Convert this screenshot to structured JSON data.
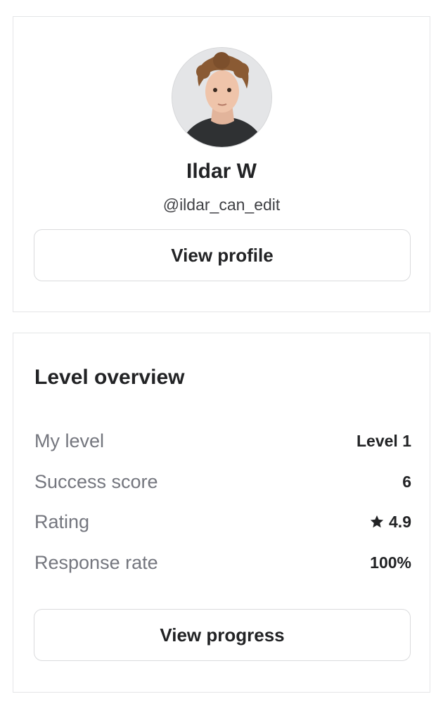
{
  "profile": {
    "name": "Ildar W",
    "handle": "@ildar_can_edit",
    "view_profile_label": "View profile"
  },
  "level_overview": {
    "title": "Level overview",
    "rows": [
      {
        "label": "My level",
        "value": "Level 1"
      },
      {
        "label": "Success score",
        "value": "6"
      },
      {
        "label": "Rating",
        "value": "4.9",
        "icon": "star-icon"
      },
      {
        "label": "Response rate",
        "value": "100%"
      }
    ],
    "view_progress_label": "View progress"
  }
}
